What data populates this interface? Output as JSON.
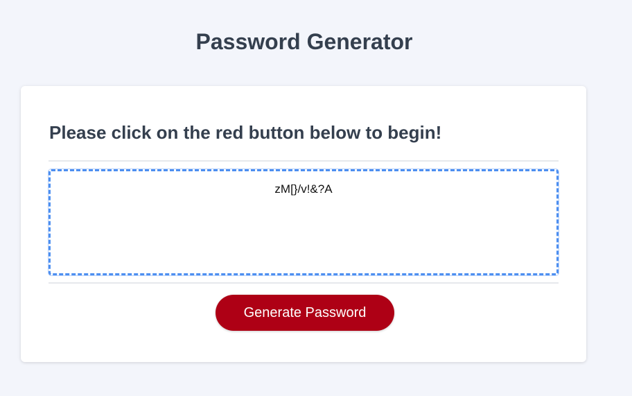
{
  "header": {
    "title": "Password Generator"
  },
  "card": {
    "heading": "Please click on the red button below to begin!",
    "password_output": {
      "value": "zM[}/v!&?A"
    },
    "generate_button_label": "Generate Password"
  },
  "colors": {
    "page_background": "#f3f5fb",
    "title_text": "#343f4e",
    "button_background": "#ae0015",
    "focus_outline": "#4d8ff0"
  }
}
